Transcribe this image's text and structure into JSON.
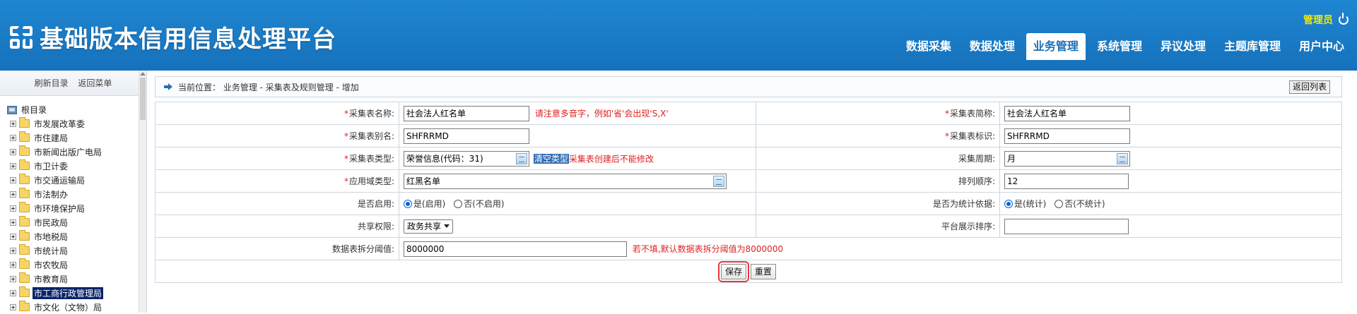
{
  "header": {
    "app_title": "基础版本信用信息处理平台",
    "user_name": "管理员",
    "nav": [
      {
        "label": "数据采集",
        "active": false
      },
      {
        "label": "数据处理",
        "active": false
      },
      {
        "label": "业务管理",
        "active": true
      },
      {
        "label": "系统管理",
        "active": false
      },
      {
        "label": "异议处理",
        "active": false
      },
      {
        "label": "主题库管理",
        "active": false
      },
      {
        "label": "用户中心",
        "active": false
      }
    ]
  },
  "sidebar": {
    "refresh_label": "刷新目录",
    "back_menu_label": "返回菜单",
    "root_label": "根目录",
    "items": [
      {
        "label": "市发展改革委"
      },
      {
        "label": "市住建局"
      },
      {
        "label": "市新闻出版广电局"
      },
      {
        "label": "市卫计委"
      },
      {
        "label": "市交通运输局"
      },
      {
        "label": "市法制办"
      },
      {
        "label": "市环境保护局"
      },
      {
        "label": "市民政局"
      },
      {
        "label": "市地税局"
      },
      {
        "label": "市统计局"
      },
      {
        "label": "市农牧局"
      },
      {
        "label": "市教育局"
      },
      {
        "label": "市工商行政管理局",
        "selected": true
      },
      {
        "label": "市文化（文物）局"
      }
    ]
  },
  "breadcrumb": {
    "text": "当前位置： 业务管理 - 采集表及规则管理 - 增加",
    "back_label": "返回列表"
  },
  "form": {
    "table_name_label": "*采集表名称:",
    "table_name_value": "社会法人红名单",
    "table_name_hint": "请注意多音字，例如'省'会出现'S,X'",
    "short_name_label": "*采集表简称:",
    "short_name_value": "社会法人红名单",
    "alias_label": "*采集表别名:",
    "alias_value": "SHFRRMD",
    "identifier_label": "*采集表标识:",
    "identifier_value": "SHFRRMD",
    "type_label": "*采集表类型:",
    "type_value": "荣誉信息(代码：31)",
    "clear_type_label": "清空类型",
    "type_hint": "采集表创建后不能修改",
    "period_label": "采集周期:",
    "period_value": "月",
    "domain_label": "*应用域类型:",
    "domain_value": "红黑名单",
    "order_label": "排列顺序:",
    "order_value": "12",
    "enabled_label": "是否启用:",
    "enabled_yes": "是(启用)",
    "enabled_no": "否(不启用)",
    "stat_label": "是否为统计依据:",
    "stat_yes": "是(统计)",
    "stat_no": "否(不统计)",
    "share_label": "共享权限:",
    "share_value": "政务共享",
    "platform_order_label": "平台展示排序:",
    "platform_order_value": "",
    "split_label": "数据表拆分阈值:",
    "split_value": "8000000",
    "split_hint": "若不填,默认数据表拆分阈值为8000000",
    "save_label": "保存",
    "reset_label": "重置"
  }
}
